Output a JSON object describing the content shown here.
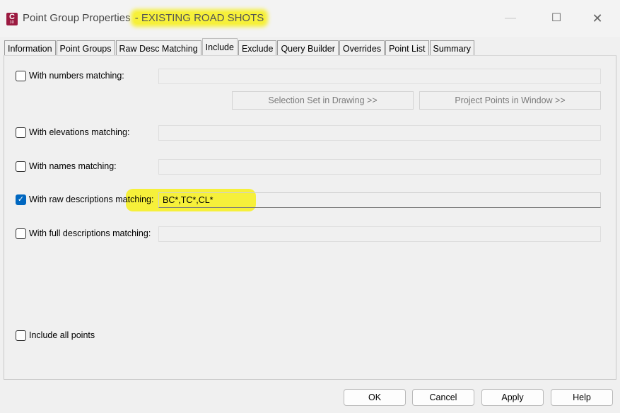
{
  "window": {
    "app_icon_letter": "C",
    "app_icon_sub": "3D",
    "title": "Point Group Properties",
    "title_highlight": "- EXISTING ROAD SHOTS",
    "minimize_glyph": "—",
    "maximize_glyph": "☐",
    "close_glyph": "✕"
  },
  "tabs": [
    {
      "label": "Information"
    },
    {
      "label": "Point Groups"
    },
    {
      "label": "Raw Desc Matching"
    },
    {
      "label": "Include",
      "active": true
    },
    {
      "label": "Exclude"
    },
    {
      "label": "Query Builder"
    },
    {
      "label": "Overrides"
    },
    {
      "label": "Point List"
    },
    {
      "label": "Summary"
    }
  ],
  "include": {
    "numbers": {
      "label": "With numbers matching:",
      "checked": false,
      "value": ""
    },
    "selection_set_button": "Selection Set in Drawing >>",
    "project_points_button": "Project Points in Window >>",
    "elevations": {
      "label": "With elevations matching:",
      "checked": false,
      "value": ""
    },
    "names": {
      "label": "With names matching:",
      "checked": false,
      "value": ""
    },
    "raw_descriptions": {
      "label": "With raw descriptions matching:",
      "checked": true,
      "value": "BC*,TC*,CL*"
    },
    "full_descriptions": {
      "label": "With full descriptions matching:",
      "checked": false,
      "value": ""
    },
    "include_all": {
      "label": "Include all points",
      "checked": false
    },
    "checkmark_glyph": "✓"
  },
  "footer": {
    "ok": "OK",
    "cancel": "Cancel",
    "apply": "Apply",
    "help": "Help"
  },
  "colors": {
    "highlight": "#f6f03a",
    "checkbox_checked": "#0067c0",
    "app_icon": "#9b1a40"
  }
}
